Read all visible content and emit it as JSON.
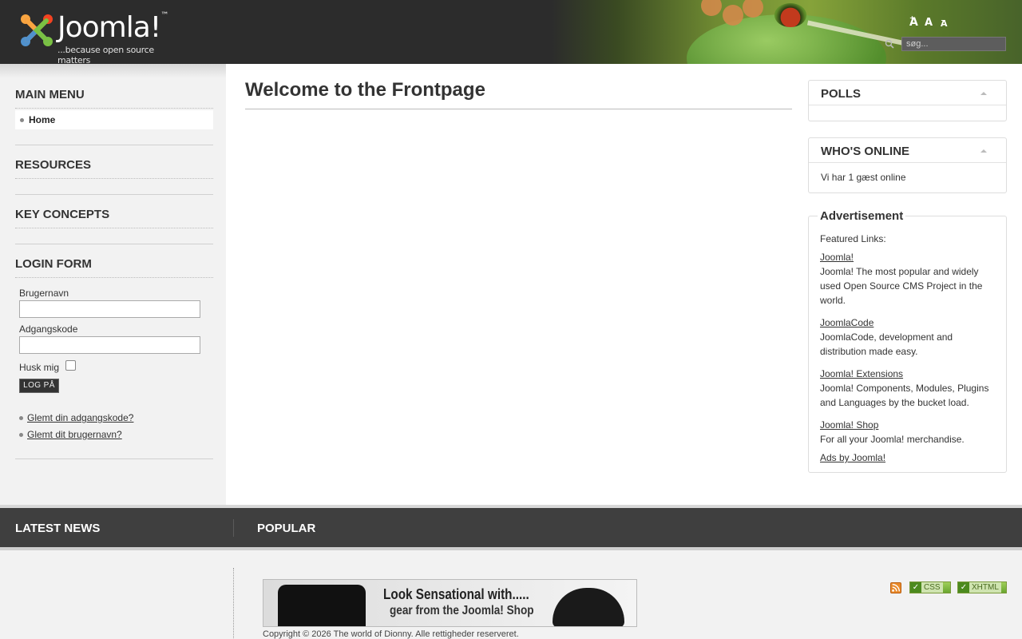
{
  "header": {
    "logo_word": "Joomla!",
    "logo_tm": "™",
    "logo_tagline": "...because open source matters",
    "font_larger": "A",
    "font_larger_sup": "+",
    "font_reset": "A",
    "font_smaller": "A",
    "font_smaller_sup": "−",
    "search_placeholder": "søg..."
  },
  "left": {
    "main_menu_title": "MAIN MENU",
    "menu_items": [
      {
        "label": "Home"
      }
    ],
    "resources_title": "RESOURCES",
    "key_concepts_title": "KEY CONCEPTS",
    "login_title": "LOGIN FORM",
    "username_label": "Brugernavn",
    "password_label": "Adgangskode",
    "remember_label": "Husk mig",
    "login_button": "LOG PÅ",
    "forgot_password": "Glemt din adgangskode?",
    "forgot_username": "Glemt dit brugernavn?"
  },
  "main": {
    "title": "Welcome to the Frontpage"
  },
  "right": {
    "polls_title": "POLLS",
    "whos_online_title": "WHO'S ONLINE",
    "online_text": "Vi har 1 gæst online",
    "ads_title": "Advertisement",
    "ads_intro": "Featured Links:",
    "ads": [
      {
        "link": "Joomla!",
        "desc": "Joomla! The most popular and widely used Open Source CMS Project in the world."
      },
      {
        "link": "JoomlaCode",
        "desc": "JoomlaCode, development and distribution made easy."
      },
      {
        "link": "Joomla! Extensions",
        "desc": "Joomla! Components, Modules, Plugins and Languages by the bucket load."
      },
      {
        "link": "Joomla! Shop",
        "desc": "For all your Joomla! merchandise."
      }
    ],
    "ads_by": "Ads by Joomla!"
  },
  "bottom": {
    "latest_news_title": "LATEST NEWS",
    "popular_title": "POPULAR"
  },
  "footer": {
    "banner_line1": "Look Sensational with.....",
    "banner_line2": "gear from the Joomla! Shop",
    "copyright": "Copyright © 2026 The world of Dionny. Alle rettigheder reserveret.",
    "badge_css": "CSS",
    "badge_xhtml": "XHTML",
    "badge_check": "✓"
  },
  "icons": {
    "search": "search-icon",
    "rss": "rss-icon",
    "bullet": "bullet-icon",
    "collapse": "collapse-arrow-icon"
  },
  "colors": {
    "header_bg": "#2c2c2c",
    "sidebar_bg": "#f2f2f2",
    "bottom_bar_bg": "#3f3f3f",
    "badge_green": "#6aa630"
  }
}
